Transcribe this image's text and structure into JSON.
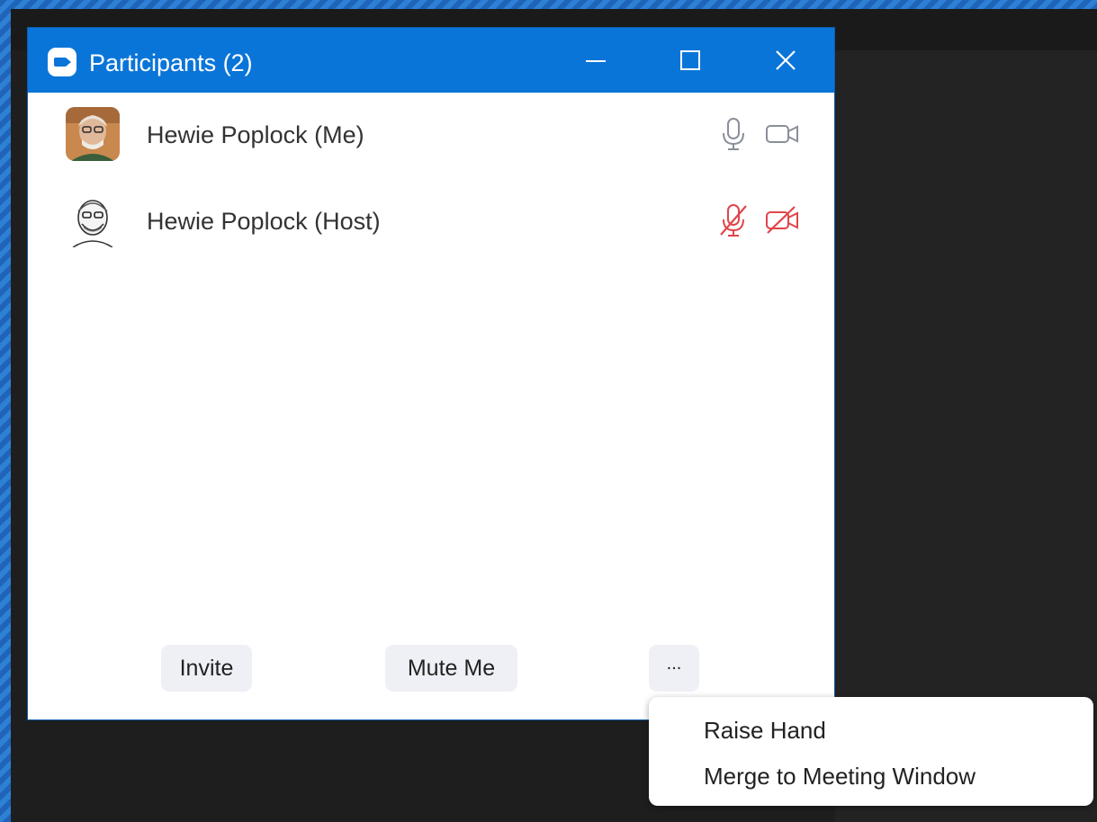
{
  "window": {
    "title": "Participants (2)",
    "icons": {
      "app": "zoom-camera-icon",
      "minimize": "minimize-icon",
      "maximize": "maximize-icon",
      "close": "close-icon"
    }
  },
  "participants": [
    {
      "name": "Hewie Poplock (Me)",
      "mic": "on",
      "video": "on",
      "mic_icon": "microphone-icon",
      "video_icon": "video-camera-icon"
    },
    {
      "name": "Hewie Poplock (Host)",
      "mic": "muted",
      "video": "off",
      "mic_icon": "microphone-muted-icon",
      "video_icon": "video-camera-off-icon"
    }
  ],
  "actions": {
    "invite": "Invite",
    "mute_me": "Mute Me",
    "more": "..."
  },
  "more_menu": [
    {
      "label": "Raise Hand"
    },
    {
      "label": "Merge to Meeting Window"
    }
  ],
  "colors": {
    "titlebar": "#0a75d8",
    "muted_red": "#e0454b",
    "button_bg": "#eef0f5",
    "icon_gray": "#8a8f99"
  }
}
